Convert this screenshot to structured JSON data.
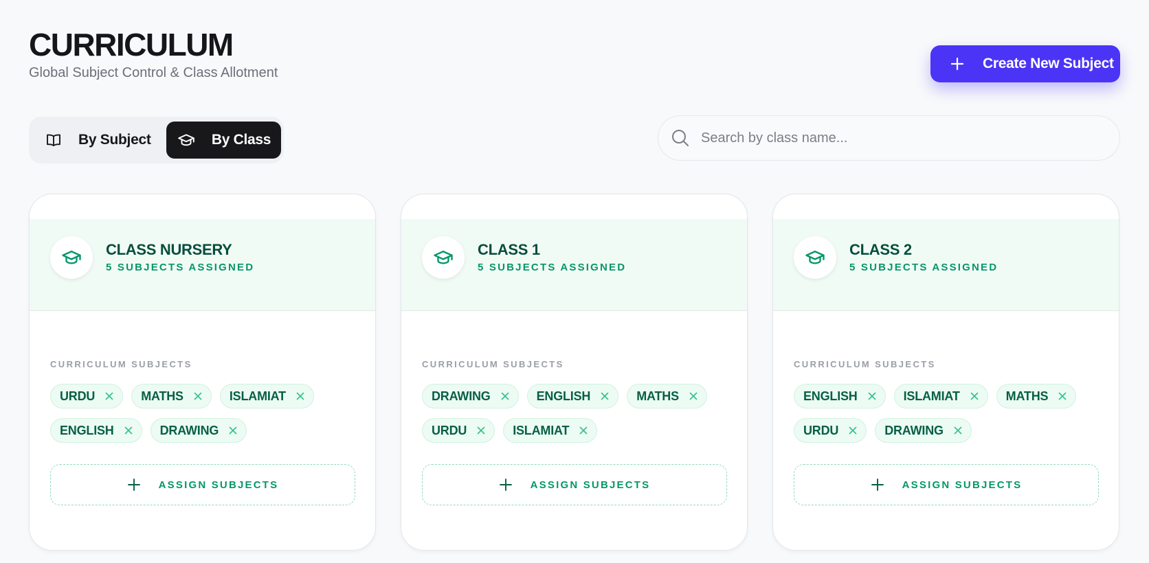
{
  "header": {
    "title": "CURRICULUM",
    "subtitle": "Global Subject Control & Class Allotment",
    "create_label": "Create New Subject"
  },
  "view_toggle": {
    "by_subject_label": "By Subject",
    "by_class_label": "By Class",
    "active": "By Class"
  },
  "search": {
    "placeholder": "Search by class name...",
    "value": ""
  },
  "cards": [
    {
      "name": "CLASS NURSERY",
      "count_label": "5 SUBJECTS ASSIGNED",
      "subjects_label": "CURRICULUM SUBJECTS",
      "subjects": [
        "URDU",
        "MATHS",
        "ISLAMIAT",
        "ENGLISH",
        "DRAWING"
      ],
      "assign_label": "ASSIGN SUBJECTS"
    },
    {
      "name": "CLASS 1",
      "count_label": "5 SUBJECTS ASSIGNED",
      "subjects_label": "CURRICULUM SUBJECTS",
      "subjects": [
        "DRAWING",
        "ENGLISH",
        "MATHS",
        "URDU",
        "ISLAMIAT"
      ],
      "assign_label": "ASSIGN SUBJECTS"
    },
    {
      "name": "CLASS 2",
      "count_label": "5 SUBJECTS ASSIGNED",
      "subjects_label": "CURRICULUM SUBJECTS",
      "subjects": [
        "ENGLISH",
        "ISLAMIAT",
        "MATHS",
        "URDU",
        "DRAWING"
      ],
      "assign_label": "ASSIGN SUBJECTS"
    }
  ],
  "icons": {
    "create": "plus-icon",
    "by_subject": "open-book-icon",
    "by_class": "graduation-cap-icon",
    "search": "search-icon",
    "class": "graduation-cap-icon",
    "remove_subject": "close-icon",
    "assign": "plus-icon"
  },
  "colors": {
    "accent": "#4b34f5",
    "active_toggle": "#18181b",
    "card_header_bg": "#f1fbf6",
    "chip_bg": "#ecfbf3",
    "chip_text": "#065f46",
    "green": "#059669",
    "dark_green": "#064e3b"
  }
}
